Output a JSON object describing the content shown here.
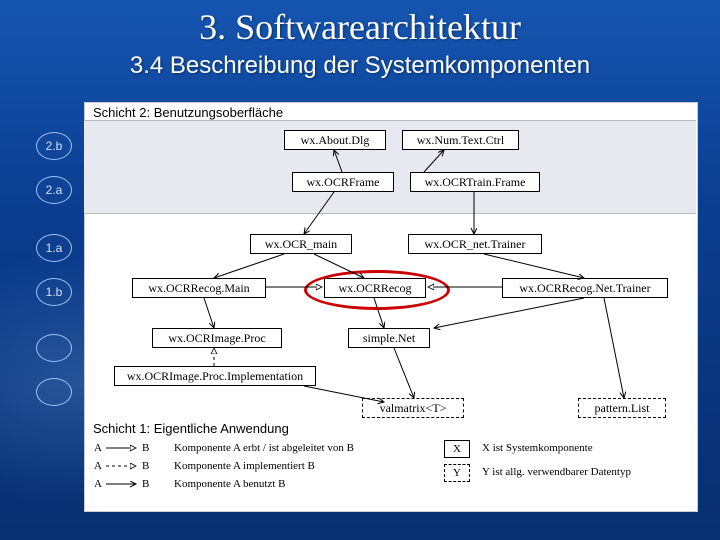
{
  "title": "3. Softwarearchitektur",
  "subtitle": "3.4 Beschreibung der Systemkomponenten",
  "layers": {
    "top": "Schicht 2: Benutzungsoberfläche",
    "bottom": "Schicht 1: Eigentliche Anwendung"
  },
  "bubbles": [
    "2.b",
    "2.a",
    "1.a",
    "1.b"
  ],
  "components": {
    "aboutDlg": "wx.About.Dlg",
    "numTextCtrl": "wx.Num.Text.Ctrl",
    "ocrFrame": "wx.OCRFrame",
    "ocrTrainFrame": "wx.OCRTrain.Frame",
    "ocrMain": "wx.OCR_main",
    "ocrNetTrainer": "wx.OCR_net.Trainer",
    "recogMain": "wx.OCRRecog.Main",
    "recog": "wx.OCRRecog",
    "recogNetTrainer": "wx.OCRRecog.Net.Trainer",
    "imageProc": "wx.OCRImage.Proc",
    "simpleNet": "simple.Net",
    "imageProcImpl": "wx.OCRImage.Proc.Implementation",
    "valmatrix": "valmatrix<T>",
    "patternList": "pattern.List"
  },
  "legend": {
    "rows": [
      {
        "a": "A",
        "b": "B",
        "text": "Komponente A erbt / ist abgeleitet von B"
      },
      {
        "a": "A",
        "b": "B",
        "text": "Komponente A implementiert B"
      },
      {
        "a": "A",
        "b": "B",
        "text": "Komponente A benutzt B"
      }
    ],
    "x": {
      "label": "X",
      "text": "X ist Systemkomponente"
    },
    "y": {
      "label": "Y",
      "text": "Y ist allg. verwendbarer Datentyp"
    }
  }
}
